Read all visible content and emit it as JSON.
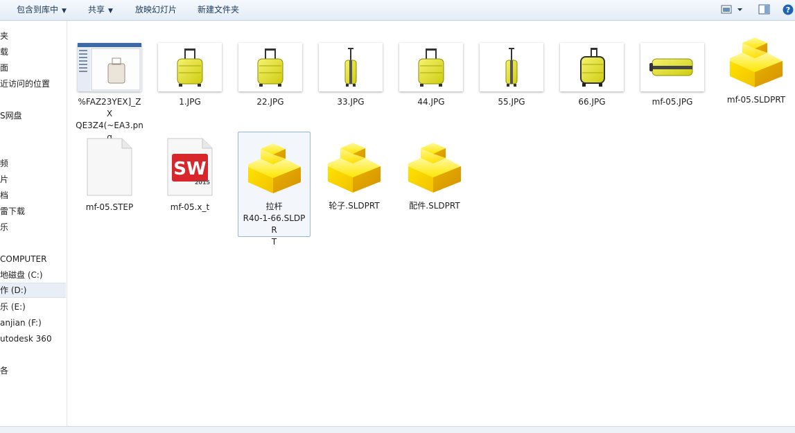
{
  "toolbar": {
    "include_library": "包含到库中",
    "share": "共享",
    "slideshow": "放映幻灯片",
    "new_folder": "新建文件夹"
  },
  "nav": {
    "items": [
      "夹",
      "载",
      "面",
      "近访问的位置",
      "S网盘",
      "频",
      "片",
      "档",
      "雷下载",
      "乐",
      "COMPUTER",
      "地磁盘 (C:)",
      "作 (D:)",
      "乐 (E:)",
      "anjian (F:)",
      "utodesk 360",
      "各"
    ]
  },
  "files": [
    {
      "name": "%FAZ23YEX]_ZX\nQE3Z4(~EA3.pn\ng",
      "kind": "screenshot"
    },
    {
      "name": "1.JPG",
      "kind": "suitcase-front"
    },
    {
      "name": "22.JPG",
      "kind": "suitcase-back"
    },
    {
      "name": "33.JPG",
      "kind": "suitcase-side"
    },
    {
      "name": "44.JPG",
      "kind": "suitcase-front"
    },
    {
      "name": "55.JPG",
      "kind": "suitcase-side"
    },
    {
      "name": "66.JPG",
      "kind": "suitcase-angle"
    },
    {
      "name": "mf-05.JPG",
      "kind": "suitcase-flat"
    },
    {
      "name": "mf-05.SLDPRT",
      "kind": "sldprt"
    },
    {
      "name": "mf-05.STEP",
      "kind": "blank-doc"
    },
    {
      "name": "mf-05.x_t",
      "kind": "sw-doc"
    },
    {
      "name": "拉杆\nR40-1-66.SLDPR\nT",
      "kind": "sldprt",
      "selected": true
    },
    {
      "name": "轮子.SLDPRT",
      "kind": "sldprt"
    },
    {
      "name": "配件.SLDPRT",
      "kind": "sldprt"
    }
  ],
  "sw_badge": {
    "letters": "SW",
    "year": "2015"
  },
  "colors": {
    "suitcase": "#e6e42a",
    "sldprt": "#f2d400",
    "toolbar_text": "#1e395b"
  }
}
